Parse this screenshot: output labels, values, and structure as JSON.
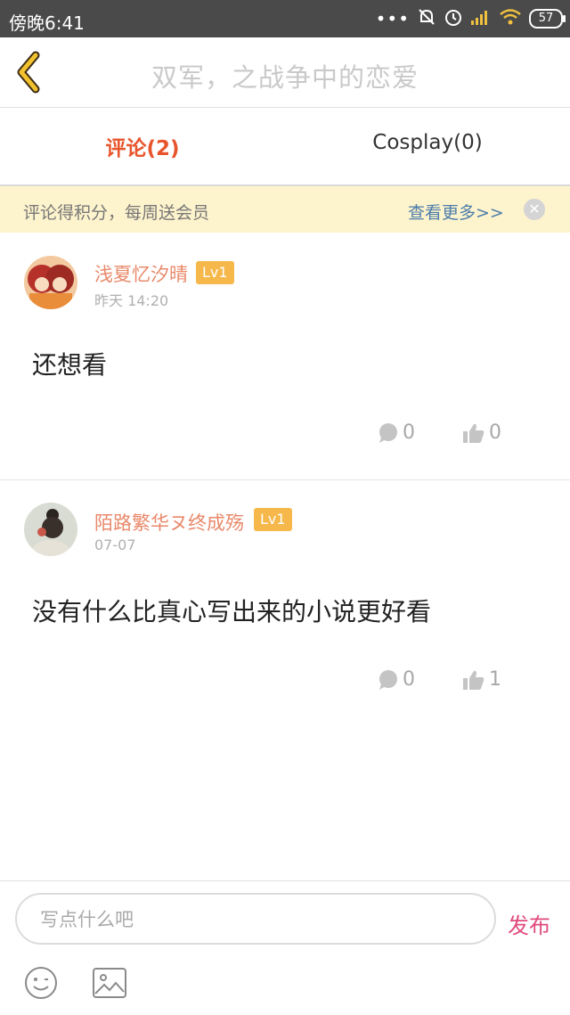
{
  "status_bar": {
    "time": "傍晚6:41",
    "battery": "57",
    "icons": [
      "more-dots-icon",
      "mute-bell-icon",
      "alarm-icon",
      "signal-icon",
      "wifi-icon",
      "battery-icon"
    ]
  },
  "header": {
    "back_icon": "chevron-left-icon",
    "title": "双军，之战争中的恋爱"
  },
  "tabs": [
    {
      "label": "评论(2)",
      "active": true
    },
    {
      "label": "Cosplay(0)",
      "active": false
    }
  ],
  "banner": {
    "message": "评论得积分，每周送会员",
    "link": "查看更多>>",
    "close_icon": "close-icon"
  },
  "comments": [
    {
      "user": "浅夏忆汐晴",
      "level": "Lv1",
      "date": "昨天 14:20",
      "text": "还想看",
      "replies": "0",
      "likes": "0"
    },
    {
      "user": "陌路繁华ヌ终成殇",
      "level": "Lv1",
      "date": "07-07",
      "text": "没有什么比真心写出来的小说更好看",
      "replies": "0",
      "likes": "1"
    }
  ],
  "composer": {
    "placeholder": "写点什么吧",
    "value": "",
    "submit_label": "发布",
    "emoji_icon": "emoji-icon",
    "image_icon": "image-icon"
  },
  "colors": {
    "accent": "#e8552c",
    "username": "#e9896b",
    "level_badge": "#f6b84a",
    "banner_bg": "#fdf3cc",
    "link": "#4c7dab",
    "publish": "#e04a7c",
    "status_bar": "#4a4a4a",
    "back_arrow": "#f2c12e"
  }
}
